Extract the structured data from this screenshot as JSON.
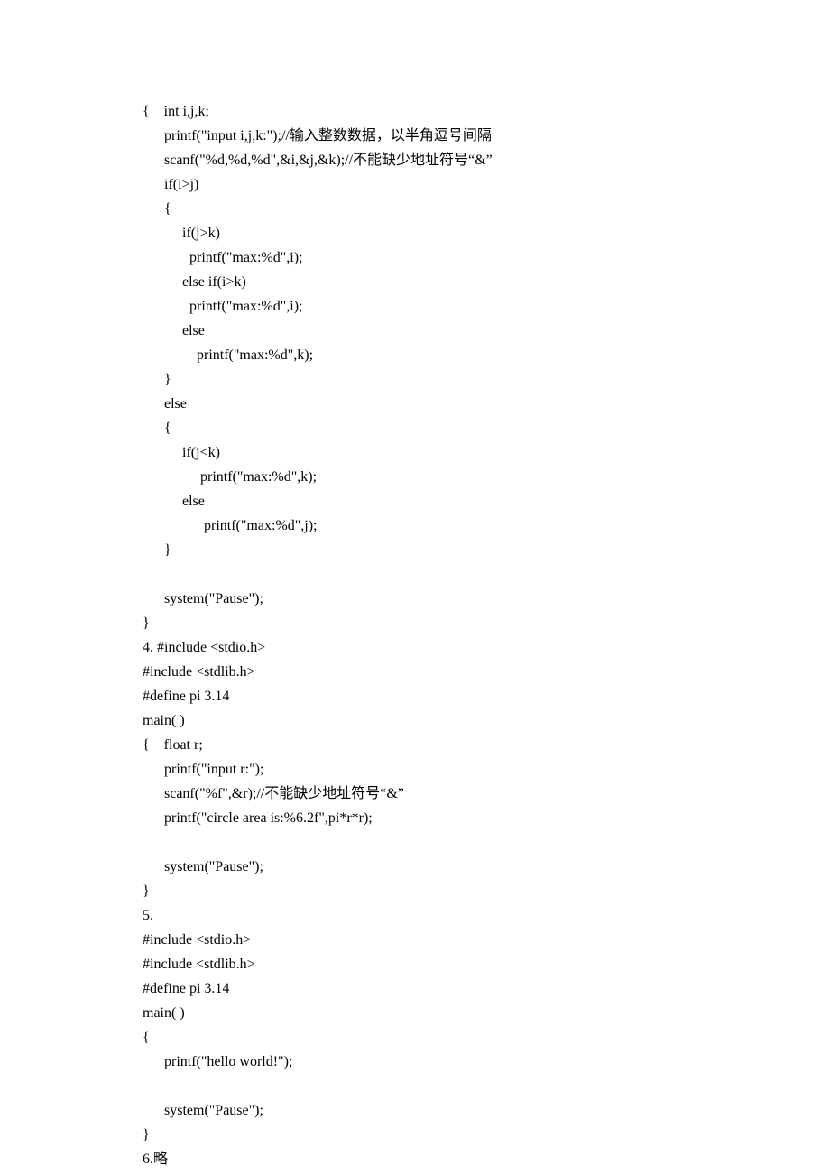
{
  "lines": [
    "{    int i,j,k;",
    "      printf(\"input i,j,k:\");//输入整数数据，以半角逗号间隔",
    "      scanf(\"%d,%d,%d\",&i,&j,&k);//不能缺少地址符号“&”",
    "      if(i>j)",
    "      {",
    "           if(j>k)",
    "             printf(\"max:%d\",i);",
    "           else if(i>k)",
    "             printf(\"max:%d\",i);",
    "           else",
    "               printf(\"max:%d\",k);",
    "      }",
    "      else",
    "      {",
    "           if(j<k)",
    "                printf(\"max:%d\",k);",
    "           else",
    "                 printf(\"max:%d\",j);",
    "      }",
    "",
    "      system(\"Pause\");",
    "}",
    "4. #include <stdio.h>",
    "#include <stdlib.h>",
    "#define pi 3.14",
    "main( )",
    "{    float r;",
    "      printf(\"input r:\");",
    "      scanf(\"%f\",&r);//不能缺少地址符号“&”",
    "      printf(\"circle area is:%6.2f\",pi*r*r);",
    "",
    "      system(\"Pause\");",
    "}",
    "5.",
    "#include <stdio.h>",
    "#include <stdlib.h>",
    "#define pi 3.14",
    "main( )",
    "{",
    "      printf(\"hello world!\");",
    "",
    "      system(\"Pause\");",
    "}",
    "6.略"
  ]
}
